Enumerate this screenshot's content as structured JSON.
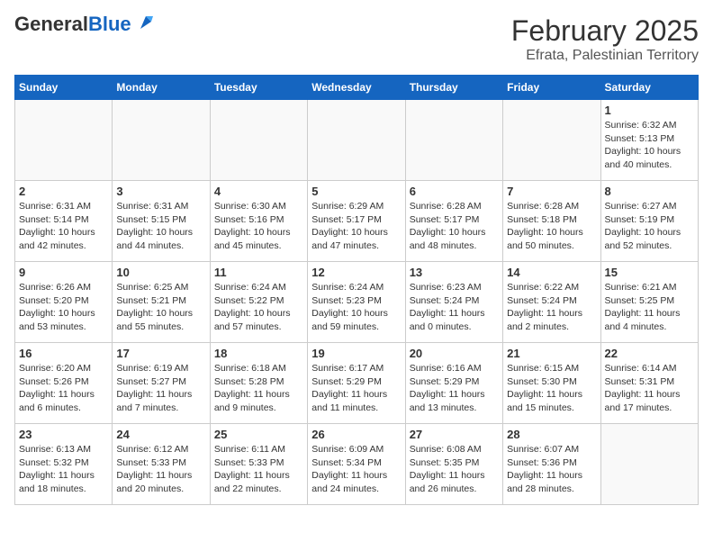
{
  "header": {
    "logo_general": "General",
    "logo_blue": "Blue",
    "title": "February 2025",
    "subtitle": "Efrata, Palestinian Territory"
  },
  "days_of_week": [
    "Sunday",
    "Monday",
    "Tuesday",
    "Wednesday",
    "Thursday",
    "Friday",
    "Saturday"
  ],
  "weeks": [
    [
      {
        "day": "",
        "info": ""
      },
      {
        "day": "",
        "info": ""
      },
      {
        "day": "",
        "info": ""
      },
      {
        "day": "",
        "info": ""
      },
      {
        "day": "",
        "info": ""
      },
      {
        "day": "",
        "info": ""
      },
      {
        "day": "1",
        "info": "Sunrise: 6:32 AM\nSunset: 5:13 PM\nDaylight: 10 hours\nand 40 minutes."
      }
    ],
    [
      {
        "day": "2",
        "info": "Sunrise: 6:31 AM\nSunset: 5:14 PM\nDaylight: 10 hours\nand 42 minutes."
      },
      {
        "day": "3",
        "info": "Sunrise: 6:31 AM\nSunset: 5:15 PM\nDaylight: 10 hours\nand 44 minutes."
      },
      {
        "day": "4",
        "info": "Sunrise: 6:30 AM\nSunset: 5:16 PM\nDaylight: 10 hours\nand 45 minutes."
      },
      {
        "day": "5",
        "info": "Sunrise: 6:29 AM\nSunset: 5:17 PM\nDaylight: 10 hours\nand 47 minutes."
      },
      {
        "day": "6",
        "info": "Sunrise: 6:28 AM\nSunset: 5:17 PM\nDaylight: 10 hours\nand 48 minutes."
      },
      {
        "day": "7",
        "info": "Sunrise: 6:28 AM\nSunset: 5:18 PM\nDaylight: 10 hours\nand 50 minutes."
      },
      {
        "day": "8",
        "info": "Sunrise: 6:27 AM\nSunset: 5:19 PM\nDaylight: 10 hours\nand 52 minutes."
      }
    ],
    [
      {
        "day": "9",
        "info": "Sunrise: 6:26 AM\nSunset: 5:20 PM\nDaylight: 10 hours\nand 53 minutes."
      },
      {
        "day": "10",
        "info": "Sunrise: 6:25 AM\nSunset: 5:21 PM\nDaylight: 10 hours\nand 55 minutes."
      },
      {
        "day": "11",
        "info": "Sunrise: 6:24 AM\nSunset: 5:22 PM\nDaylight: 10 hours\nand 57 minutes."
      },
      {
        "day": "12",
        "info": "Sunrise: 6:24 AM\nSunset: 5:23 PM\nDaylight: 10 hours\nand 59 minutes."
      },
      {
        "day": "13",
        "info": "Sunrise: 6:23 AM\nSunset: 5:24 PM\nDaylight: 11 hours\nand 0 minutes."
      },
      {
        "day": "14",
        "info": "Sunrise: 6:22 AM\nSunset: 5:24 PM\nDaylight: 11 hours\nand 2 minutes."
      },
      {
        "day": "15",
        "info": "Sunrise: 6:21 AM\nSunset: 5:25 PM\nDaylight: 11 hours\nand 4 minutes."
      }
    ],
    [
      {
        "day": "16",
        "info": "Sunrise: 6:20 AM\nSunset: 5:26 PM\nDaylight: 11 hours\nand 6 minutes."
      },
      {
        "day": "17",
        "info": "Sunrise: 6:19 AM\nSunset: 5:27 PM\nDaylight: 11 hours\nand 7 minutes."
      },
      {
        "day": "18",
        "info": "Sunrise: 6:18 AM\nSunset: 5:28 PM\nDaylight: 11 hours\nand 9 minutes."
      },
      {
        "day": "19",
        "info": "Sunrise: 6:17 AM\nSunset: 5:29 PM\nDaylight: 11 hours\nand 11 minutes."
      },
      {
        "day": "20",
        "info": "Sunrise: 6:16 AM\nSunset: 5:29 PM\nDaylight: 11 hours\nand 13 minutes."
      },
      {
        "day": "21",
        "info": "Sunrise: 6:15 AM\nSunset: 5:30 PM\nDaylight: 11 hours\nand 15 minutes."
      },
      {
        "day": "22",
        "info": "Sunrise: 6:14 AM\nSunset: 5:31 PM\nDaylight: 11 hours\nand 17 minutes."
      }
    ],
    [
      {
        "day": "23",
        "info": "Sunrise: 6:13 AM\nSunset: 5:32 PM\nDaylight: 11 hours\nand 18 minutes."
      },
      {
        "day": "24",
        "info": "Sunrise: 6:12 AM\nSunset: 5:33 PM\nDaylight: 11 hours\nand 20 minutes."
      },
      {
        "day": "25",
        "info": "Sunrise: 6:11 AM\nSunset: 5:33 PM\nDaylight: 11 hours\nand 22 minutes."
      },
      {
        "day": "26",
        "info": "Sunrise: 6:09 AM\nSunset: 5:34 PM\nDaylight: 11 hours\nand 24 minutes."
      },
      {
        "day": "27",
        "info": "Sunrise: 6:08 AM\nSunset: 5:35 PM\nDaylight: 11 hours\nand 26 minutes."
      },
      {
        "day": "28",
        "info": "Sunrise: 6:07 AM\nSunset: 5:36 PM\nDaylight: 11 hours\nand 28 minutes."
      },
      {
        "day": "",
        "info": ""
      }
    ]
  ]
}
